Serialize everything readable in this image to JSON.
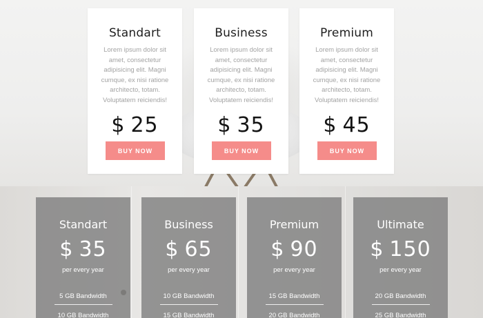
{
  "top_pricing": {
    "cards": [
      {
        "title": "Standart",
        "description": "Lorem ipsum dolor sit amet, consectetur adipisicing elit. Magni cumque, ex nisi ratione architecto, totam. Voluptatem reiciendis!",
        "currency": "$",
        "amount": "25",
        "button_label": "BUY NOW"
      },
      {
        "title": "Business",
        "description": "Lorem ipsum dolor sit amet, consectetur adipisicing elit. Magni cumque, ex nisi ratione architecto, totam. Voluptatem reiciendis!",
        "currency": "$",
        "amount": "35",
        "button_label": "BUY NOW"
      },
      {
        "title": "Premium",
        "description": "Lorem ipsum dolor sit amet, consectetur adipisicing elit. Magni cumque, ex nisi ratione architecto, totam. Voluptatem reiciendis!",
        "currency": "$",
        "amount": "45",
        "button_label": "BUY NOW"
      }
    ]
  },
  "plans": {
    "items": [
      {
        "title": "Standart",
        "currency": "$",
        "amount": "35",
        "period": "per every year",
        "features": [
          "5 GB Bandwidth",
          "10 GB Bandwidth"
        ]
      },
      {
        "title": "Business",
        "currency": "$",
        "amount": "65",
        "period": "per every year",
        "features": [
          "10 GB Bandwidth",
          "15 GB Bandwidth"
        ]
      },
      {
        "title": "Premium",
        "currency": "$",
        "amount": "90",
        "period": "per every year",
        "features": [
          "15 GB Bandwidth",
          "20 GB Bandwidth"
        ]
      },
      {
        "title": "Ultimate",
        "currency": "$",
        "amount": "150",
        "period": "per every year",
        "features": [
          "20 GB Bandwidth",
          "25 GB Bandwidth"
        ]
      }
    ]
  },
  "colors": {
    "accent_button": "#f58c8a",
    "plan_card": "#808080",
    "card_background": "#ffffff"
  }
}
